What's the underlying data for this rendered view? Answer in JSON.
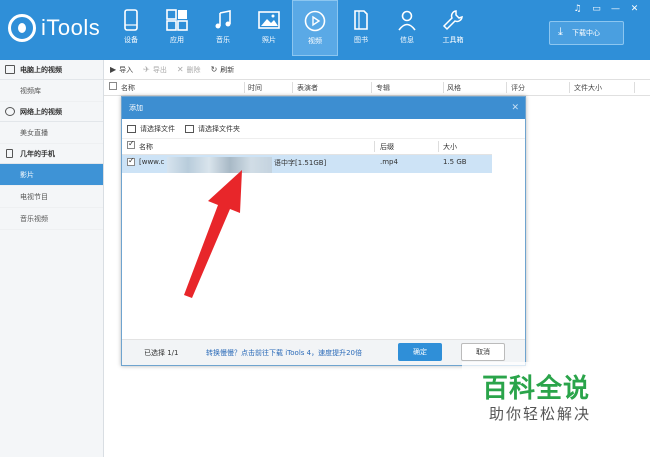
{
  "app": {
    "name": "iTools"
  },
  "nav": [
    {
      "label": "设备",
      "icon": "phone-icon"
    },
    {
      "label": "应用",
      "icon": "apps-icon"
    },
    {
      "label": "音乐",
      "icon": "music-icon"
    },
    {
      "label": "照片",
      "icon": "photo-icon"
    },
    {
      "label": "视频",
      "icon": "video-icon"
    },
    {
      "label": "图书",
      "icon": "book-icon"
    },
    {
      "label": "信息",
      "icon": "person-icon"
    },
    {
      "label": "工具箱",
      "icon": "wrench-icon"
    }
  ],
  "window_buttons": [
    "♫",
    "▭",
    "—",
    "✕"
  ],
  "download_center": {
    "label": "下载中心"
  },
  "sidebar": {
    "groups": [
      {
        "title": "电脑上的视频",
        "items": [
          "视频库"
        ]
      },
      {
        "title": "网络上的视频",
        "items": [
          "美女直播"
        ]
      },
      {
        "title": "几年的手机",
        "items": [
          "影片",
          "电视节目",
          "音乐视频"
        ]
      }
    ],
    "active_item": "影片"
  },
  "toolbar": {
    "import": "导入",
    "export": "导出",
    "delete": "删除",
    "refresh": "刷新"
  },
  "columns": {
    "name": "名称",
    "time": "时间",
    "artist": "表演者",
    "album": "专辑",
    "genre": "风格",
    "rating": "评分",
    "size": "文件大小"
  },
  "dialog": {
    "title": "添加",
    "close": "✕",
    "select_file": "请选择文件",
    "select_folder": "请选择文件夹",
    "headers": {
      "name": "名称",
      "ext": "后缀",
      "size": "大小"
    },
    "row": {
      "name_prefix": "[www.c",
      "name_suffix": "语中字[1.51GB]",
      "ext": ".mp4",
      "size": "1.5 GB"
    },
    "footer": {
      "selected": "已选择 1/1",
      "tip": "转换慢慢？点击前往下载 iTools 4，速度提升20倍",
      "ok": "确定",
      "cancel": "取消"
    }
  },
  "watermark": {
    "title": "百科全说",
    "subtitle": "助你轻松解决"
  },
  "colors": {
    "topbar": "#2f8fd8",
    "active": "#3e93d6",
    "arrow": "#e8262a",
    "watermark": "#2aa44a"
  }
}
